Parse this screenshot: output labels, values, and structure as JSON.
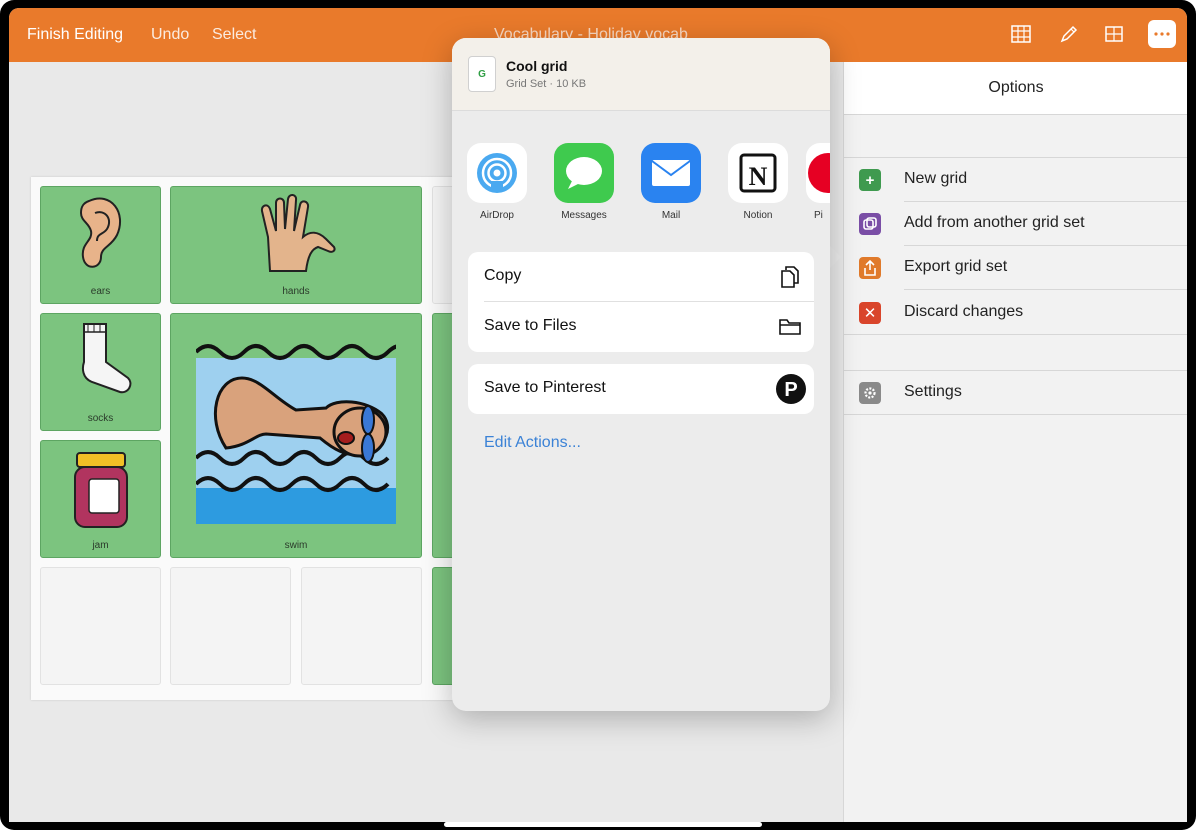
{
  "topbar": {
    "finish_editing": "Finish Editing",
    "undo": "Undo",
    "select": "Select",
    "title": "Vocabulary - Holiday vocab",
    "icons": [
      "grid-cells-icon",
      "pencil-icon",
      "grid-layout-icon",
      "more-icon"
    ]
  },
  "grid": {
    "cells": [
      {
        "label": "ears",
        "icon": "ear-icon"
      },
      {
        "label": "hands",
        "icon": "hand-icon"
      },
      {
        "label": "socks",
        "icon": "sock-icon"
      },
      {
        "label": "swim",
        "icon": "swimmer-icon"
      },
      {
        "label": "jam",
        "icon": "jam-jar-icon"
      }
    ]
  },
  "share_sheet": {
    "file_name": "Cool grid",
    "file_meta": "Grid Set · 10 KB",
    "apps": [
      {
        "label": "AirDrop",
        "icon": "airdrop-icon"
      },
      {
        "label": "Messages",
        "icon": "messages-icon"
      },
      {
        "label": "Mail",
        "icon": "mail-icon"
      },
      {
        "label": "Notion",
        "icon": "notion-icon"
      },
      {
        "label": "Pi",
        "icon": "pinterest-icon"
      }
    ],
    "actions": [
      {
        "label": "Copy",
        "icon": "copy-icon"
      },
      {
        "label": "Save to Files",
        "icon": "folder-icon"
      },
      {
        "label": "Save to Pinterest",
        "icon": "pinterest-icon"
      }
    ],
    "edit_actions": "Edit Actions..."
  },
  "options": {
    "title": "Options",
    "items": [
      {
        "label": "New grid",
        "icon": "plus-icon",
        "color": "#3f9a4f"
      },
      {
        "label": "Add from another grid set",
        "icon": "copy-stack-icon",
        "color": "#7a4ea6"
      },
      {
        "label": "Export grid set",
        "icon": "export-icon",
        "color": "#e07a2b"
      },
      {
        "label": "Discard changes",
        "icon": "close-icon",
        "color": "#d9452b"
      },
      {
        "label": "Settings",
        "icon": "gear-icon",
        "color": "#8a8a8a"
      }
    ]
  },
  "colors": {
    "topbar": "#e97a2b",
    "cell_green": "#7cc47f",
    "link_blue": "#3b82d6"
  }
}
